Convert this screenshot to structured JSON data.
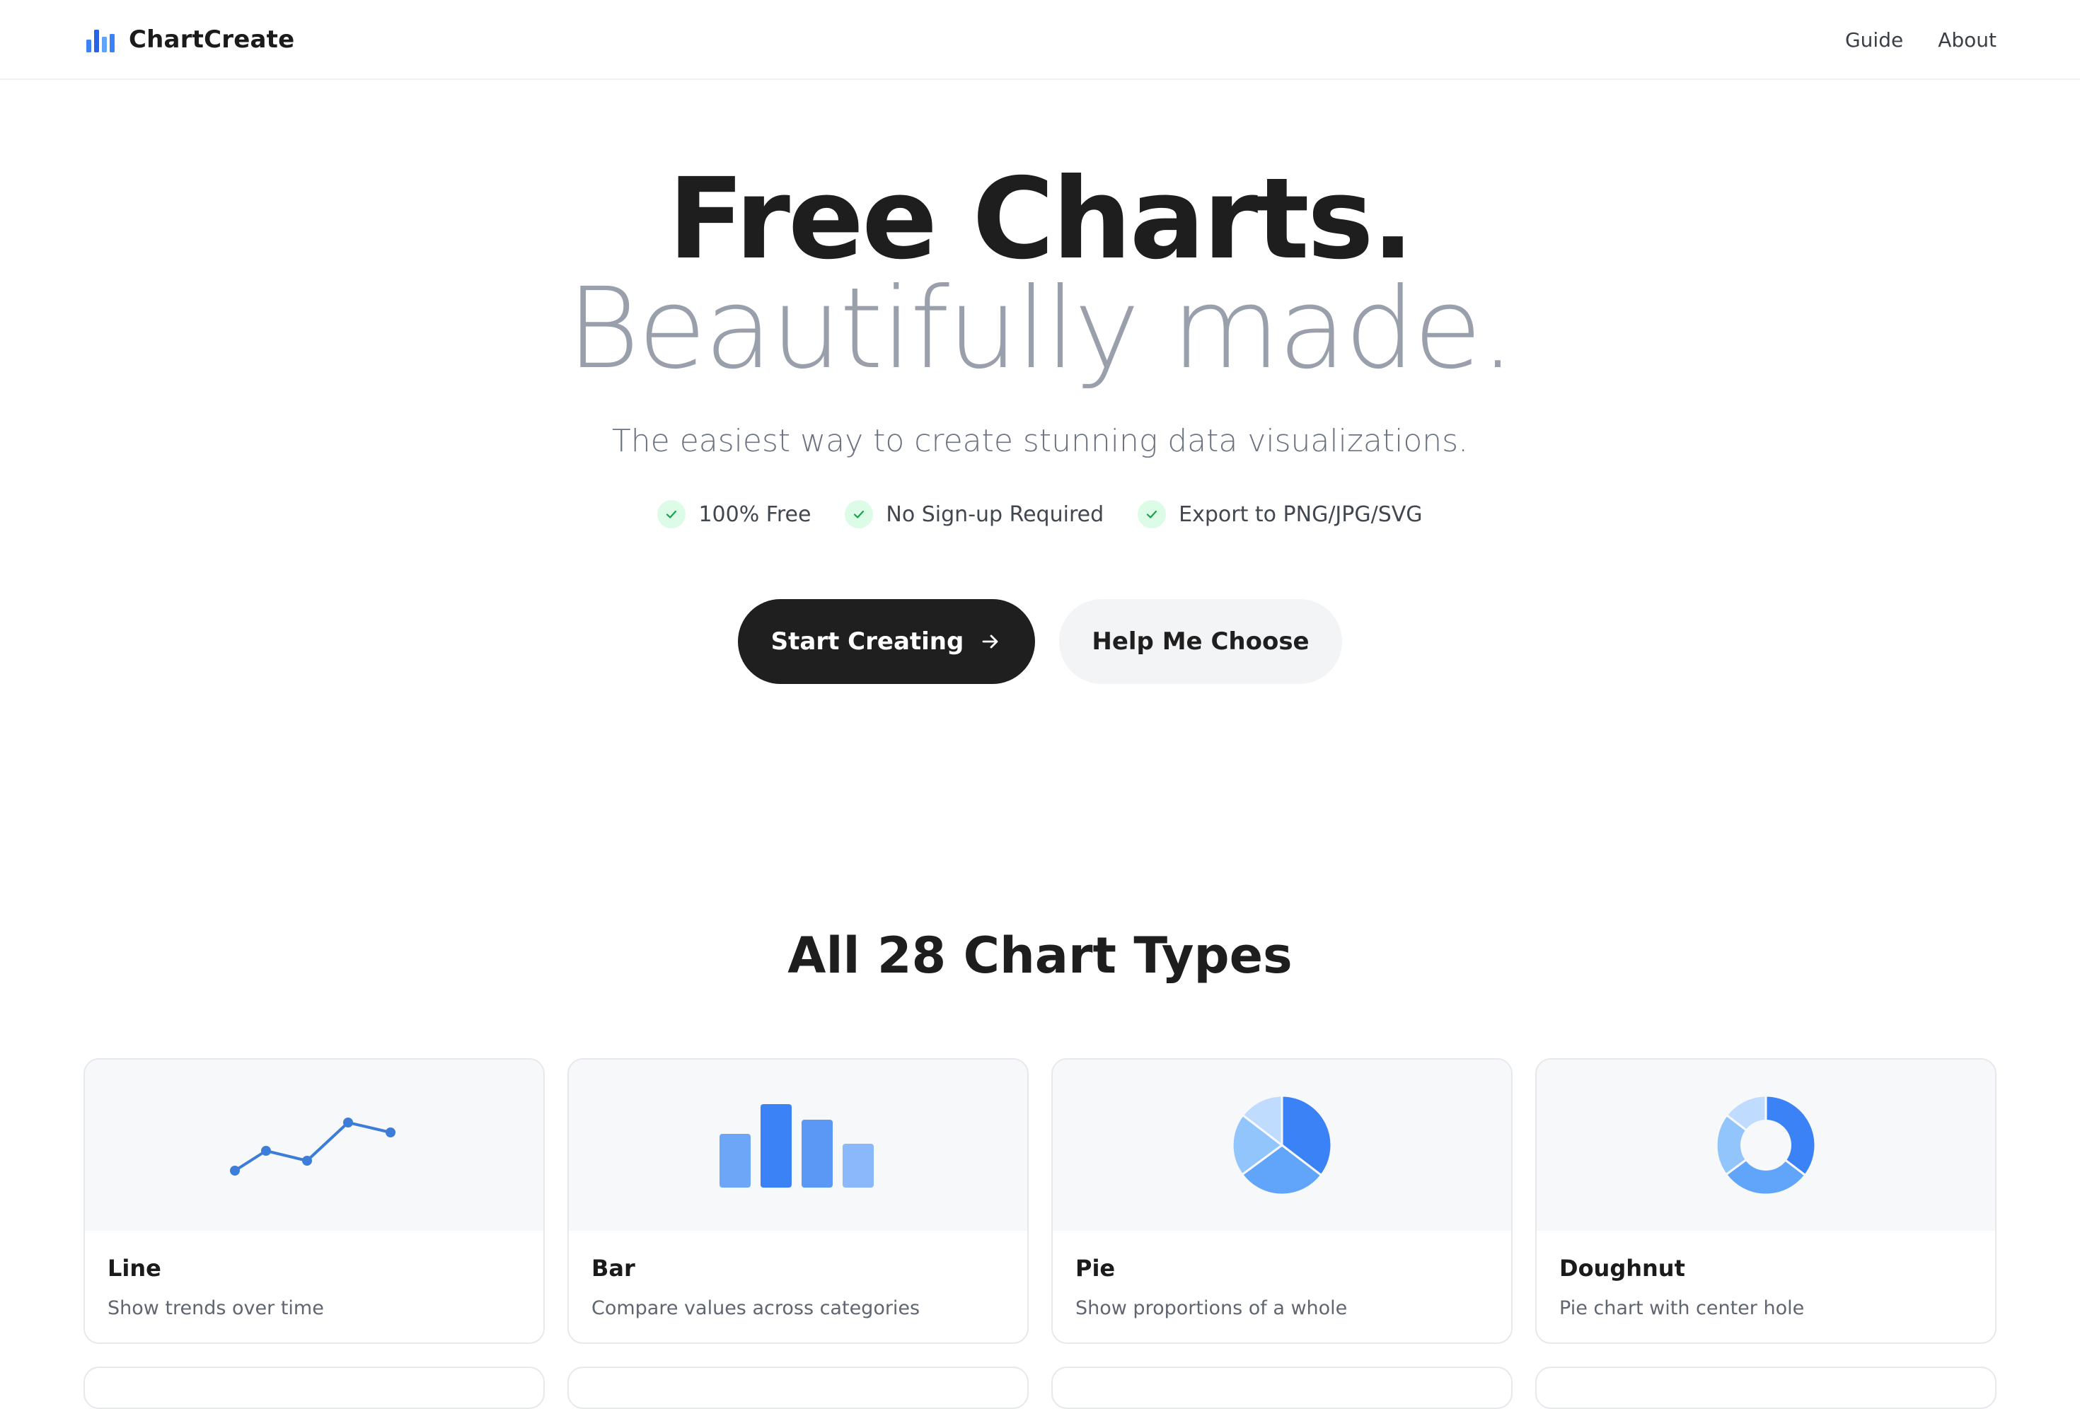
{
  "header": {
    "brand_name": "ChartCreate",
    "brand_icon": "bar-chart-icon",
    "nav": [
      {
        "label": "Guide"
      },
      {
        "label": "About"
      }
    ]
  },
  "hero": {
    "headline_line1": "Free Charts.",
    "headline_line2": "Beautifully made.",
    "subtitle": "The easiest way to create stunning data visualizations.",
    "features": [
      {
        "label": "100% Free",
        "icon": "check-icon"
      },
      {
        "label": "No Sign-up Required",
        "icon": "check-icon"
      },
      {
        "label": "Export to PNG/JPG/SVG",
        "icon": "check-icon"
      }
    ],
    "primary_button": {
      "label": "Start Creating",
      "icon": "arrow-right-icon"
    },
    "secondary_button": {
      "label": "Help Me Choose"
    }
  },
  "chart_types": {
    "title": "All 28 Chart Types",
    "cards": [
      {
        "title": "Line",
        "description": "Show trends over time",
        "icon": "line-chart-icon"
      },
      {
        "title": "Bar",
        "description": "Compare values across categories",
        "icon": "bar-chart-icon"
      },
      {
        "title": "Pie",
        "description": "Show proportions of a whole",
        "icon": "pie-chart-icon"
      },
      {
        "title": "Doughnut",
        "description": "Pie chart with center hole",
        "icon": "doughnut-chart-icon"
      }
    ]
  },
  "colors": {
    "accent": "#3b82f6",
    "accent_light": "#60a5fa",
    "accent_lighter": "#93c5fd",
    "accent_lightest": "#bfdbfe",
    "dark": "#1f1f1f",
    "check_bg": "#dcfce7",
    "check_fg": "#16a34a"
  }
}
